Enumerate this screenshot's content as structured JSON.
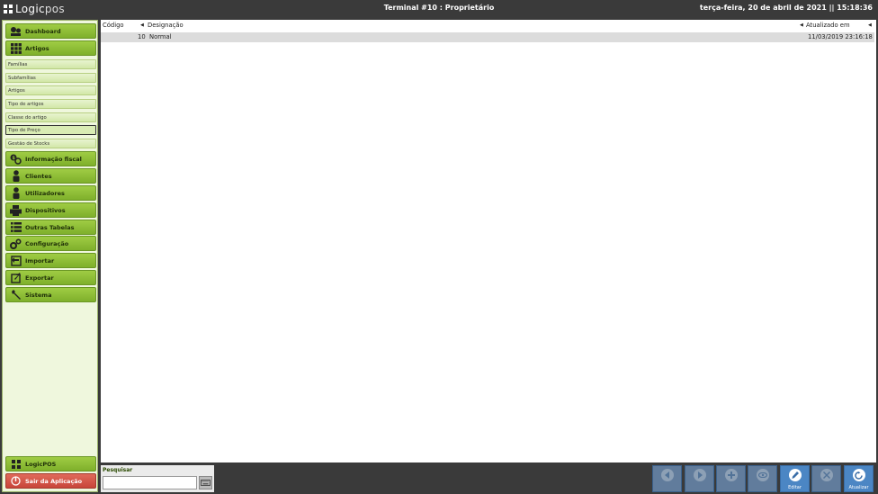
{
  "header": {
    "logo_main": "Logic",
    "logo_suffix": "pos",
    "title": "Terminal #10 : Proprietário",
    "datetime": "terça-feira, 20 de abril de 2021 || 15:18:36"
  },
  "sidebar": {
    "menu_top": [
      {
        "label": "Dashboard",
        "icon": "dashboard-icon"
      },
      {
        "label": "Artigos",
        "icon": "grid-icon"
      }
    ],
    "sub_items": [
      {
        "label": "Famílias"
      },
      {
        "label": "Subfamílias"
      },
      {
        "label": "Artigos"
      },
      {
        "label": "Tipo de artigos"
      },
      {
        "label": "Classe do artigo"
      },
      {
        "label": "Tipo de Preço"
      },
      {
        "label": "Gestão de Stocks"
      }
    ],
    "menu_rest": [
      {
        "label": "Informação fiscal",
        "icon": "fiscal-icon"
      },
      {
        "label": "Clientes",
        "icon": "person-icon"
      },
      {
        "label": "Utilizadores",
        "icon": "user-icon"
      },
      {
        "label": "Dispositivos",
        "icon": "printer-icon"
      },
      {
        "label": "Outras Tabelas",
        "icon": "list-icon"
      },
      {
        "label": "Configuração",
        "icon": "gears-icon"
      },
      {
        "label": "Importar",
        "icon": "import-icon"
      },
      {
        "label": "Exportar",
        "icon": "export-icon"
      },
      {
        "label": "Sistema",
        "icon": "wrench-icon"
      }
    ],
    "logicpos_label": "LogicPOS",
    "exit_label": "Sair da Aplicação"
  },
  "table": {
    "columns": [
      "Código",
      "Designação",
      "Atualizado em"
    ],
    "rows": [
      {
        "codigo": "10",
        "designacao": "Normal",
        "atualizado": "11/03/2019 23:16:18"
      }
    ]
  },
  "search": {
    "label": "Pesquisar",
    "value": ""
  },
  "actions": [
    {
      "label": "",
      "icon": "prev-icon",
      "enabled": false
    },
    {
      "label": "",
      "icon": "next-icon",
      "enabled": false
    },
    {
      "label": "",
      "icon": "add-icon",
      "enabled": false
    },
    {
      "label": "",
      "icon": "view-icon",
      "enabled": false
    },
    {
      "label": "Editar",
      "icon": "edit-icon",
      "enabled": true
    },
    {
      "label": "",
      "icon": "delete-icon",
      "enabled": false
    },
    {
      "label": "Atualizar",
      "icon": "refresh-icon",
      "enabled": true
    }
  ],
  "colors": {
    "menu_green": "#8bbd35",
    "action_blue": "#4b86c4",
    "exit_red": "#c8453a",
    "topbar": "#3a3a3a"
  }
}
